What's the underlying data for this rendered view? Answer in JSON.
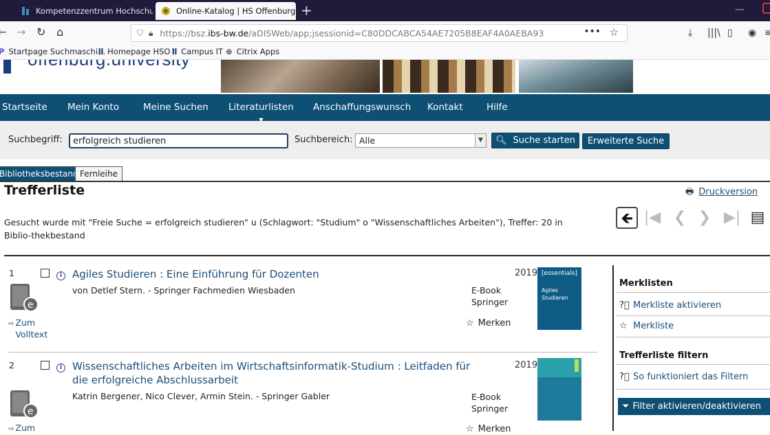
{
  "browser": {
    "tabs": [
      {
        "label": "Kompetenzzentrum Hochschu"
      },
      {
        "label": "Online-Katalog | HS Offenburg"
      }
    ],
    "url_prefix": "https://bsz.",
    "url_host": "ibs-bw.de",
    "url_rest": "/aDISWeb/app;jsessionid=C80DDCABCA54AE7205B8EAF4A0AEBA93",
    "bookmarks": [
      {
        "icon": "search-icon",
        "label": "Startpage Suchmaschi..."
      },
      {
        "icon": "hso-icon",
        "label": "Homepage HSO"
      },
      {
        "icon": "hso-icon",
        "label": "Campus IT"
      },
      {
        "icon": "globe-icon",
        "label": "Citrix Apps"
      }
    ]
  },
  "site": {
    "logo_text": "offenburg.university",
    "nav": [
      "Startseite",
      "Mein Konto",
      "Meine Suchen",
      "Literaturlisten",
      "Anschaffungswunsch",
      "Kontakt",
      "Hilfe"
    ],
    "search": {
      "label": "Suchbegriff:",
      "value": "erfolgreich studieren",
      "bereich_label": "Suchbereich:",
      "bereich_value": "Alle",
      "start_label": "Suche starten",
      "advanced_label": "Erweiterte Suche"
    },
    "tabs": [
      "Bibliotheksbestand",
      "Fernleihe"
    ]
  },
  "results": {
    "title": "Trefferliste",
    "print_label": "Druckversion",
    "query_text": "Gesucht wurde mit \"Freie Suche = erfolgreich studieren\" u (Schlagwort: \"Studium\" o \"Wissenschaftliches Arbeiten\"), Treffer: 20 in Biblio-thekbestand",
    "items": [
      {
        "num": "1",
        "title": "Agiles Studieren : Eine Einführung für Dozenten",
        "authors": "von Detlef Stern. - Springer Fachmedien Wiesbaden",
        "year": "2019",
        "type": "E-Book Springer",
        "merken": "Merken",
        "fulltext": "Zum Volltext",
        "cover_top": "[essentials]",
        "cover_title": "Agiles Studieren"
      },
      {
        "num": "2",
        "title": "Wissenschaftliches Arbeiten im Wirtschaftsinformatik-Studium : Leitfaden für die erfolgreiche Abschlussarbeit",
        "authors": "Katrin Bergener, Nico Clever, Armin Stein. - Springer Gabler",
        "year": "2019",
        "type": "E-Book Springer",
        "merken": "Merken",
        "fulltext": "Zum"
      }
    ]
  },
  "sidebar": {
    "merklisten_heading": "Merklisten",
    "merkliste_activate": "Merkliste aktivieren",
    "merkliste": "Merkliste",
    "filter_heading": "Trefferliste filtern",
    "filter_howto": "So funktioniert das Filtern",
    "filter_toggle": "Filter aktivieren/deaktivieren"
  },
  "colors": {
    "nav_blue": "#0e4f74",
    "link_blue": "#1a4e7a",
    "tabbar": "#1f1b3a"
  }
}
